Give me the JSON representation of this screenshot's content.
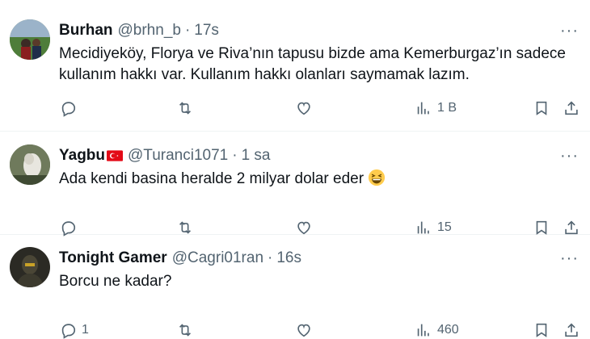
{
  "tweets": [
    {
      "name": "Burhan",
      "handle": "@brhn_b",
      "sep": "·",
      "time": "17s",
      "text_lines": [
        "Mecidiyeköy, Florya ve Riva’nın tapusu bizde ama Kemerburgaz’ın sadece",
        "kullanım hakkı var. Kullanım hakkı olanları saymamak lazım."
      ],
      "replies": "",
      "views": "1 B",
      "more": "···"
    },
    {
      "name": "Yagbu",
      "handle": "@Turanci1071",
      "sep": "·",
      "time": "1 sa",
      "text": "Ada kendi basina heralde 2 milyar dolar eder",
      "replies": "",
      "views": "15",
      "more": "···"
    },
    {
      "name": "Tonight Gamer",
      "handle": "@Cagri01ran",
      "sep": "·",
      "time": "16s",
      "text": "Borcu ne kadar?",
      "replies": "1",
      "views": "460",
      "more": "···"
    }
  ],
  "icons": {
    "reply": "reply-icon",
    "retweet": "retweet-icon",
    "like": "like-icon",
    "views": "views-icon",
    "bookmark": "bookmark-icon",
    "share": "share-icon",
    "flag": "turkey-flag-icon",
    "emoji": "grinning-squinting-face-emoji"
  },
  "colors": {
    "text": "#0f1419",
    "secondary": "#536471",
    "divider": "#eff3f4",
    "flag_red": "#e30a17"
  }
}
